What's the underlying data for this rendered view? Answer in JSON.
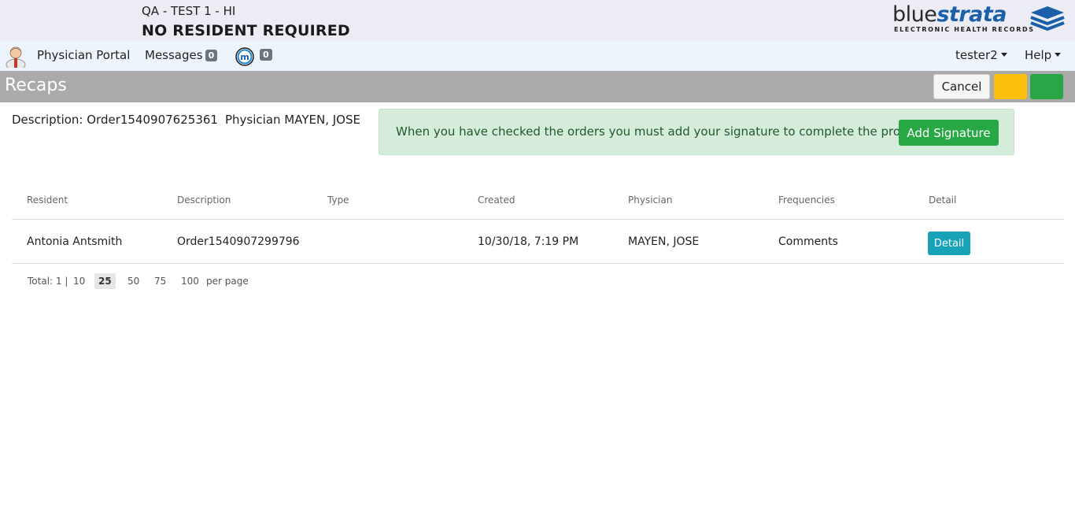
{
  "header": {
    "facility": "QA - TEST 1 - HI",
    "resident": "NO RESIDENT REQUIRED",
    "logo": {
      "word1": "blue",
      "word2": "strata",
      "tagline": "ELECTRONIC HEALTH RECORDS"
    }
  },
  "nav": {
    "portal": "Physician Portal",
    "messages": "Messages",
    "messages_count": "0",
    "m_count": "0",
    "user": "tester2",
    "help": "Help"
  },
  "titlebar": {
    "title": "Recaps",
    "cancel": "Cancel",
    "colors": {
      "yellow": "#fcc00c",
      "green": "#29a646"
    }
  },
  "info": {
    "description": "Description: Order1540907625361",
    "physician": "Physician MAYEN, JOSE"
  },
  "alert": {
    "text": "When you have checked the orders you must add your signature to complete the process.",
    "button": "Add Signature"
  },
  "table": {
    "headers": [
      "Resident",
      "Description",
      "Type",
      "Created",
      "Physician",
      "Frequencies",
      "Detail"
    ],
    "rows": [
      {
        "resident": "Antonia Antsmith",
        "description": "Order1540907299796",
        "type": "",
        "created": "10/30/18, 7:19 PM",
        "physician": "MAYEN, JOSE",
        "frequencies": "Comments",
        "detail": "Detail"
      }
    ]
  },
  "pagination": {
    "total": "Total: 1 |",
    "sizes": [
      "10",
      "25",
      "50",
      "75",
      "100"
    ],
    "selected": "25",
    "suffix": "per page"
  }
}
